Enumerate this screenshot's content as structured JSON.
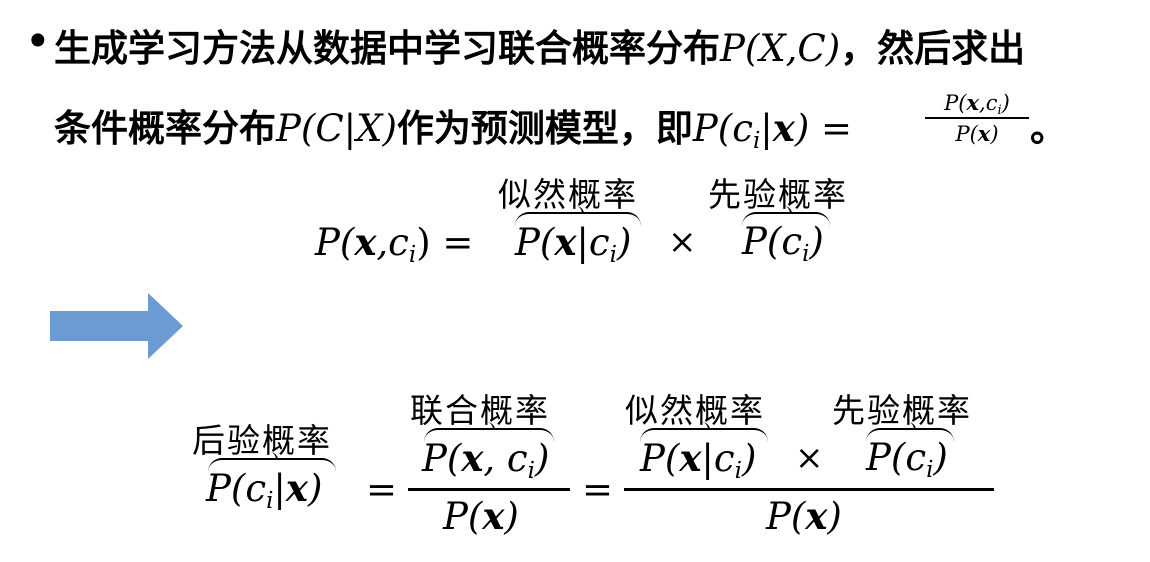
{
  "bullet": "•",
  "line1": {
    "text": "生成学习方法从数据中学习联合概率分布",
    "math": "P(X,C)",
    "tail": "，然后求出"
  },
  "line2": {
    "text": "条件概率分布",
    "math": "P(C|X)",
    "mid": "作为预测模型，即",
    "lhs": "P(c",
    "lhs_sub": "i",
    "lhs_end": "|x) = ",
    "frac_num": "P(x,c",
    "frac_num_sub": "i",
    "frac_num_end": ")",
    "frac_den": "P(x)",
    "end": "。"
  },
  "eq1": {
    "lhs": "P(x,c",
    "lhs_sub": "i",
    "lhs_end": ") =",
    "likelihood_label": "似然概率",
    "likelihood": "P(x|c",
    "likelihood_sub": "i",
    "likelihood_end": ")",
    "times": "×",
    "prior_label": "先验概率",
    "prior": "P(c",
    "prior_sub": "i",
    "prior_end": ")"
  },
  "arrow": {
    "color": "#6b9bd2"
  },
  "eq2": {
    "posterior_label": "后验概率",
    "posterior": "P(c",
    "posterior_sub": "i",
    "posterior_end": "|x)",
    "eq": "=",
    "joint_label": "联合概率",
    "joint": "P(x, c",
    "joint_sub": "i",
    "joint_end": ")",
    "den1": "P(x)",
    "eq2": "=",
    "likelihood_label": "似然概率",
    "likelihood": "P(x|c",
    "likelihood_sub": "i",
    "likelihood_end": ")",
    "times": "×",
    "prior_label": "先验概率",
    "prior": "P(c",
    "prior_sub": "i",
    "prior_end": ")",
    "den2": "P(x)"
  }
}
